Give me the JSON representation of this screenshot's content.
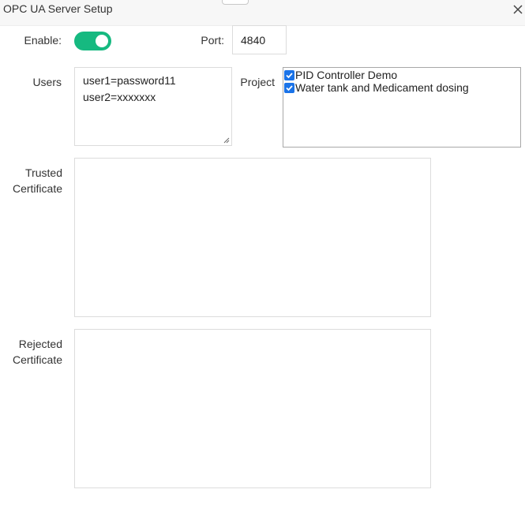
{
  "dialog": {
    "title": "OPC UA Server Setup",
    "close_icon": "close-icon"
  },
  "form": {
    "enable": {
      "label": "Enable:",
      "on": true,
      "color": "#16b980"
    },
    "port": {
      "label": "Port:",
      "value": "4840"
    },
    "users": {
      "label": "Users",
      "lines": [
        "user1=password11",
        "user2=xxxxxxx"
      ]
    },
    "project": {
      "label": "Project",
      "items": [
        {
          "label": "PID Controller Demo",
          "checked": true
        },
        {
          "label": "Water tank and Medicament dosing",
          "checked": true
        }
      ],
      "check_color": "#1a73e8"
    },
    "trusted_certificate": {
      "label_line1": "Trusted",
      "label_line2": "Certificate",
      "value": ""
    },
    "rejected_certificate": {
      "label_line1": "Rejected",
      "label_line2": "Certificate",
      "value": ""
    }
  }
}
